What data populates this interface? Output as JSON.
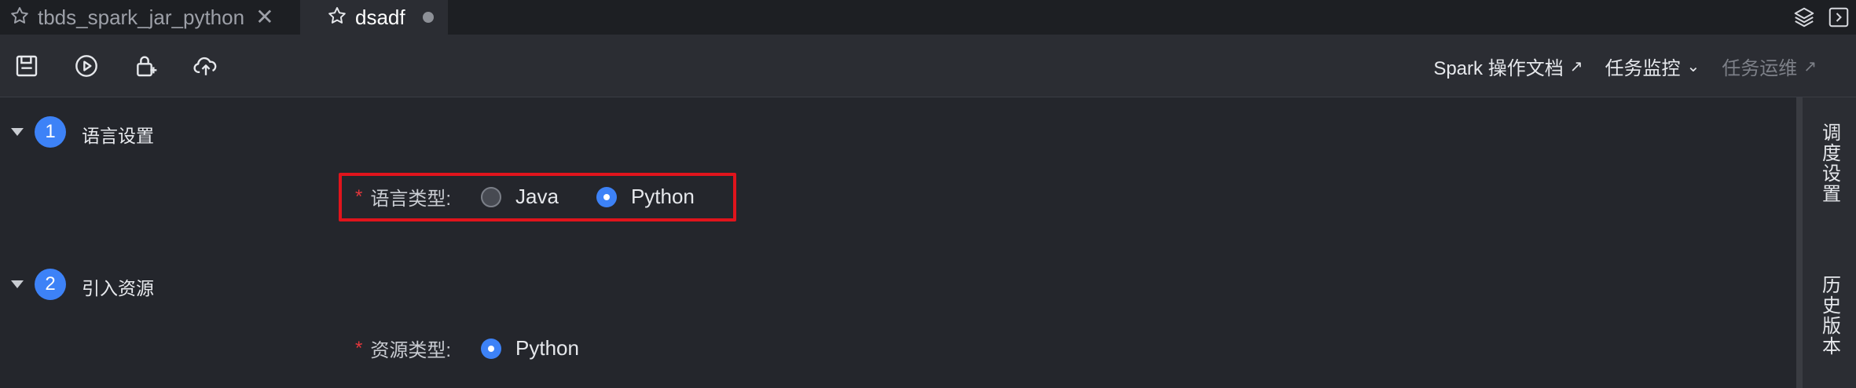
{
  "tabs": [
    {
      "label": "tbds_spark_jar_python",
      "state": "inactive",
      "icon": "star-icon",
      "action_icon": "close-icon"
    },
    {
      "label": "dsadf",
      "state": "active",
      "icon": "star-icon",
      "action_icon": "unsaved-dot"
    }
  ],
  "tabbar_right_icons": [
    "layers-icon",
    "expand-panel-icon"
  ],
  "toolbar": {
    "buttons": [
      "save-icon",
      "run-icon",
      "lock-add-icon",
      "cloud-upload-icon"
    ],
    "links": [
      {
        "label": "Spark 操作文档",
        "suffix": "↗",
        "enabled": true
      },
      {
        "label": "任务监控",
        "suffix": "⌄",
        "enabled": true
      },
      {
        "label": "任务运维",
        "suffix": "↗",
        "enabled": false
      }
    ]
  },
  "sections": [
    {
      "number": "1",
      "title": "语言设置"
    },
    {
      "number": "2",
      "title": "引入资源"
    }
  ],
  "language_field": {
    "required_mark": "*",
    "label": "语言类型:",
    "options": [
      "Java",
      "Python"
    ],
    "selected": "Python"
  },
  "resource_field": {
    "required_mark": "*",
    "label": "资源类型:",
    "options": [
      "Python"
    ],
    "selected": "Python"
  },
  "right_sidebar": {
    "items": [
      "调度设置",
      "历史版本"
    ]
  },
  "colors": {
    "accent": "#3d82f7",
    "highlight": "#e0141c",
    "required": "#e2373c",
    "background": "#24262c"
  }
}
